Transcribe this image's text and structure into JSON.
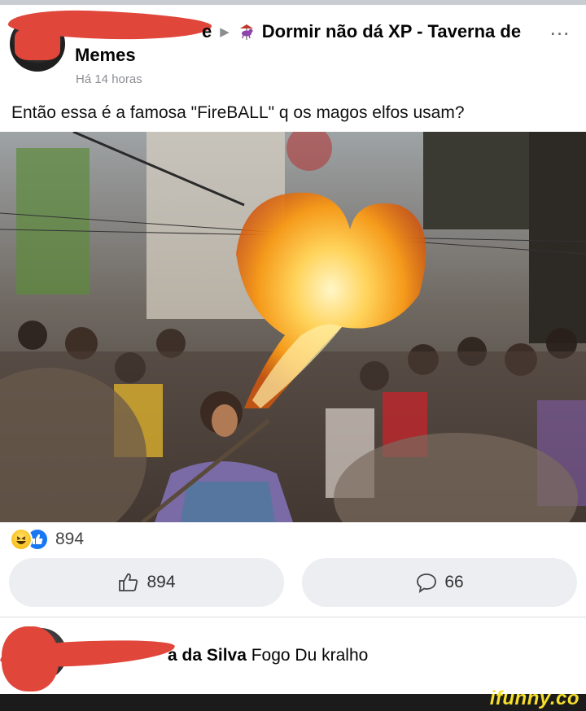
{
  "post": {
    "group_title_tail": "e",
    "group_name_line1": "Dormir não dá XP - Taverna de",
    "group_name_line2": "Memes",
    "timestamp": "Há 14 horas",
    "text": "Então essa é a famosa \"FireBALL\" q os magos elfos usam?",
    "icons": {
      "arrow": "right-arrow-icon",
      "group": "carousel-horse-icon",
      "more": "more-dots-icon"
    }
  },
  "reactions": {
    "emoji": [
      "laughing-face-icon",
      "thumbs-up-icon"
    ],
    "count": "894"
  },
  "actions": {
    "like_count": "894",
    "comment_count": "66"
  },
  "comment": {
    "author_visible": "a da Silva",
    "text": "Fogo Du kralho"
  },
  "watermark": "ifunny.co",
  "colors": {
    "redaction": "#e0463a",
    "pill_bg": "#eceef1",
    "like_blue": "#1877f2",
    "watermark_yellow": "#f6df2b"
  }
}
